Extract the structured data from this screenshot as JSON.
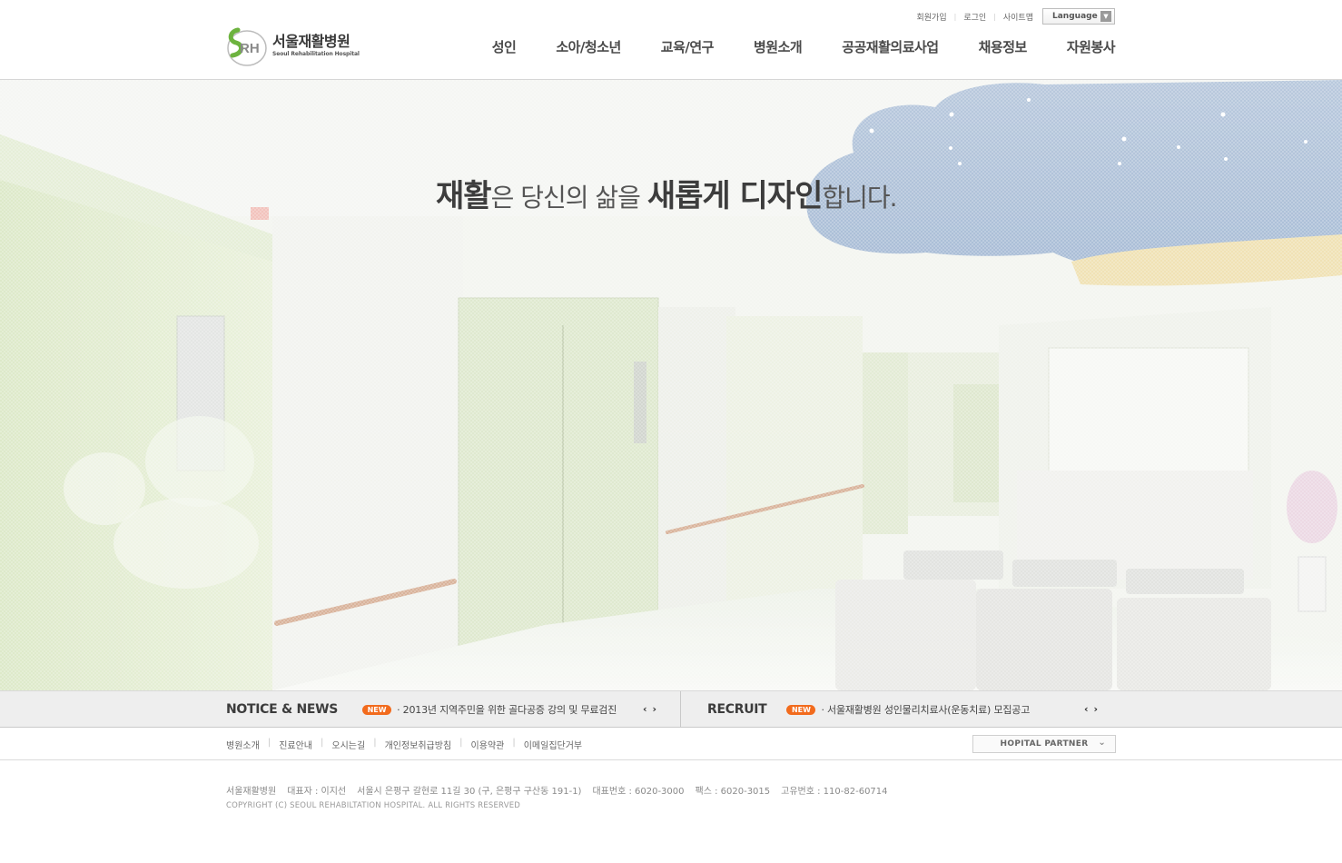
{
  "header": {
    "logo": {
      "kor": "서울재활병원",
      "eng": "Seoul Rehabilitation Hospital",
      "mark": "SRH"
    },
    "util_links": [
      "회원가입",
      "로그인",
      "사이트맵"
    ],
    "language": {
      "label": "Language",
      "icon": "chevron-down-icon"
    },
    "nav": [
      "성인",
      "소아/청소년",
      "교육/연구",
      "병원소개",
      "공공재활의료사업",
      "채용정보",
      "자원봉사"
    ]
  },
  "hero": {
    "slogan": {
      "p1": "재활",
      "p2": "은 당신의 삶을 ",
      "p3": "새롭게 디자인",
      "p4": "합니다."
    }
  },
  "notice": {
    "title": "NOTICE & NEWS",
    "badge": "NEW",
    "text": "· 2013년 지역주민을 위한 골다공증 강의 및 무료검진",
    "prev": "‹",
    "next": "›"
  },
  "recruit": {
    "title": "RECRUIT",
    "badge": "NEW",
    "text": "· 서울재활병원 성인물리치료사(운동치료) 모집공고",
    "prev": "‹",
    "next": "›"
  },
  "footer": {
    "links": [
      "병원소개",
      "진료안내",
      "오시는길",
      "개인정보취급방침",
      "이용약관",
      "이메일집단거부"
    ],
    "partner": "HOPITAL PARTNER",
    "info": {
      "name": "서울재활병원",
      "ceo": "대표자 : 이지선",
      "address": "서울시 은평구 갈현로 11길 30 (구, 은평구 구산동 191-1)",
      "tel": "대표번호 : 6020-3000",
      "fax": "팩스 : 6020-3015",
      "biz": "고유번호 : 110-82-60714"
    },
    "copyright": "COPYRIGHT (C) SEOUL REHABILTATION HOSPITAL. ALL RIGHTS RESERVED"
  },
  "colors": {
    "accent_green": "#7ab648",
    "new_badge": "#f26b1d",
    "ceiling_blue": "#8ba9c9"
  }
}
